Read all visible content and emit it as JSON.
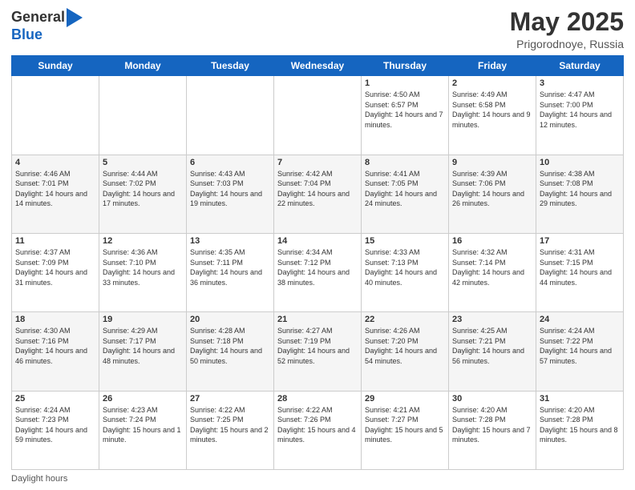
{
  "header": {
    "logo_general": "General",
    "logo_blue": "Blue",
    "title": "May 2025",
    "subtitle": "Prigorodnoye, Russia"
  },
  "weekdays": [
    "Sunday",
    "Monday",
    "Tuesday",
    "Wednesday",
    "Thursday",
    "Friday",
    "Saturday"
  ],
  "weeks": [
    [
      {
        "day": "",
        "info": ""
      },
      {
        "day": "",
        "info": ""
      },
      {
        "day": "",
        "info": ""
      },
      {
        "day": "",
        "info": ""
      },
      {
        "day": "1",
        "info": "Sunrise: 4:50 AM\nSunset: 6:57 PM\nDaylight: 14 hours and 7 minutes."
      },
      {
        "day": "2",
        "info": "Sunrise: 4:49 AM\nSunset: 6:58 PM\nDaylight: 14 hours and 9 minutes."
      },
      {
        "day": "3",
        "info": "Sunrise: 4:47 AM\nSunset: 7:00 PM\nDaylight: 14 hours and 12 minutes."
      }
    ],
    [
      {
        "day": "4",
        "info": "Sunrise: 4:46 AM\nSunset: 7:01 PM\nDaylight: 14 hours and 14 minutes."
      },
      {
        "day": "5",
        "info": "Sunrise: 4:44 AM\nSunset: 7:02 PM\nDaylight: 14 hours and 17 minutes."
      },
      {
        "day": "6",
        "info": "Sunrise: 4:43 AM\nSunset: 7:03 PM\nDaylight: 14 hours and 19 minutes."
      },
      {
        "day": "7",
        "info": "Sunrise: 4:42 AM\nSunset: 7:04 PM\nDaylight: 14 hours and 22 minutes."
      },
      {
        "day": "8",
        "info": "Sunrise: 4:41 AM\nSunset: 7:05 PM\nDaylight: 14 hours and 24 minutes."
      },
      {
        "day": "9",
        "info": "Sunrise: 4:39 AM\nSunset: 7:06 PM\nDaylight: 14 hours and 26 minutes."
      },
      {
        "day": "10",
        "info": "Sunrise: 4:38 AM\nSunset: 7:08 PM\nDaylight: 14 hours and 29 minutes."
      }
    ],
    [
      {
        "day": "11",
        "info": "Sunrise: 4:37 AM\nSunset: 7:09 PM\nDaylight: 14 hours and 31 minutes."
      },
      {
        "day": "12",
        "info": "Sunrise: 4:36 AM\nSunset: 7:10 PM\nDaylight: 14 hours and 33 minutes."
      },
      {
        "day": "13",
        "info": "Sunrise: 4:35 AM\nSunset: 7:11 PM\nDaylight: 14 hours and 36 minutes."
      },
      {
        "day": "14",
        "info": "Sunrise: 4:34 AM\nSunset: 7:12 PM\nDaylight: 14 hours and 38 minutes."
      },
      {
        "day": "15",
        "info": "Sunrise: 4:33 AM\nSunset: 7:13 PM\nDaylight: 14 hours and 40 minutes."
      },
      {
        "day": "16",
        "info": "Sunrise: 4:32 AM\nSunset: 7:14 PM\nDaylight: 14 hours and 42 minutes."
      },
      {
        "day": "17",
        "info": "Sunrise: 4:31 AM\nSunset: 7:15 PM\nDaylight: 14 hours and 44 minutes."
      }
    ],
    [
      {
        "day": "18",
        "info": "Sunrise: 4:30 AM\nSunset: 7:16 PM\nDaylight: 14 hours and 46 minutes."
      },
      {
        "day": "19",
        "info": "Sunrise: 4:29 AM\nSunset: 7:17 PM\nDaylight: 14 hours and 48 minutes."
      },
      {
        "day": "20",
        "info": "Sunrise: 4:28 AM\nSunset: 7:18 PM\nDaylight: 14 hours and 50 minutes."
      },
      {
        "day": "21",
        "info": "Sunrise: 4:27 AM\nSunset: 7:19 PM\nDaylight: 14 hours and 52 minutes."
      },
      {
        "day": "22",
        "info": "Sunrise: 4:26 AM\nSunset: 7:20 PM\nDaylight: 14 hours and 54 minutes."
      },
      {
        "day": "23",
        "info": "Sunrise: 4:25 AM\nSunset: 7:21 PM\nDaylight: 14 hours and 56 minutes."
      },
      {
        "day": "24",
        "info": "Sunrise: 4:24 AM\nSunset: 7:22 PM\nDaylight: 14 hours and 57 minutes."
      }
    ],
    [
      {
        "day": "25",
        "info": "Sunrise: 4:24 AM\nSunset: 7:23 PM\nDaylight: 14 hours and 59 minutes."
      },
      {
        "day": "26",
        "info": "Sunrise: 4:23 AM\nSunset: 7:24 PM\nDaylight: 15 hours and 1 minute."
      },
      {
        "day": "27",
        "info": "Sunrise: 4:22 AM\nSunset: 7:25 PM\nDaylight: 15 hours and 2 minutes."
      },
      {
        "day": "28",
        "info": "Sunrise: 4:22 AM\nSunset: 7:26 PM\nDaylight: 15 hours and 4 minutes."
      },
      {
        "day": "29",
        "info": "Sunrise: 4:21 AM\nSunset: 7:27 PM\nDaylight: 15 hours and 5 minutes."
      },
      {
        "day": "30",
        "info": "Sunrise: 4:20 AM\nSunset: 7:28 PM\nDaylight: 15 hours and 7 minutes."
      },
      {
        "day": "31",
        "info": "Sunrise: 4:20 AM\nSunset: 7:28 PM\nDaylight: 15 hours and 8 minutes."
      }
    ]
  ],
  "footer": {
    "daylight_label": "Daylight hours"
  }
}
